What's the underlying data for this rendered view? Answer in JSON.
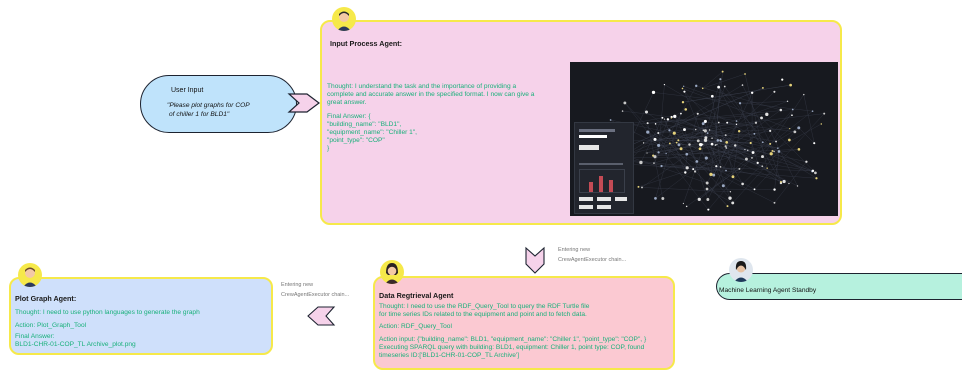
{
  "user_input": {
    "title": "User Input",
    "prompt_line1": "\"Please plot graphs for COP",
    "prompt_line2": "of chiller 1 for BLD1\""
  },
  "input_agent": {
    "title": "Input Process Agent:",
    "thought_l1": "Thought:  I understand the task and the importance of providing a",
    "thought_l2": "complete and accurate answer in the specified format. I now can give a",
    "thought_l3": "great answer.",
    "final_l1": "Final Answer: {",
    "final_l2": "\"building_name\": \"BLD1\",",
    "final_l3": "\"equipment_name\": \"Chiller 1\",",
    "final_l4": "\"point_type\": \"COP\"",
    "final_l5": "}"
  },
  "retrieval_notes": {
    "line1": "Entering new",
    "line2": "CrewAgentExecutor chain..."
  },
  "data_agent": {
    "title": "Data Regtrieval Agent",
    "thought_l1": "Thought: I need to use the RDF_Query_Tool to query the RDF Turtle file",
    "thought_l2": "for time series IDs related to the equipment and point and to fetch data.",
    "action": "Action: RDF_Query_Tool",
    "input_l1": "Action input: {\"building_name\": BLD1, \"equipment_name\": \"Chiller 1\", \"point_type\": \"COP\", }",
    "input_l2": "Executing SPARQL query with building: BLD1, equipment: Chiller 1, point type: COP, found",
    "input_l3": "timeseries ID:['BLD1-CHR-01-COP_TL Archive']"
  },
  "plot_notes": {
    "line1": "Entering new",
    "line2": "CrewAgentExecutor chain..."
  },
  "plot_agent": {
    "title": "Plot Graph Agent:",
    "thought": "Thought: I need to use python languages to generate the graph",
    "action": "Action: Plot_Graph_Tool",
    "final_l1": "Final Answer:",
    "final_l2": "BLD1-CHR-01-COP_TL Archive_plot.png"
  },
  "ml_agent": {
    "title": "Machine Learning Agent Standby"
  },
  "colors": {
    "yellow_border": "#f6e94a",
    "input_bg": "#f6d2ea",
    "data_bg": "#fbc9d2",
    "plot_bg": "#cfe0fb",
    "ml_bg": "#b6f1de",
    "user_bg": "#bfe3fb",
    "arrow_fill": "#f6d2ea",
    "text_green": "#18b07a"
  }
}
